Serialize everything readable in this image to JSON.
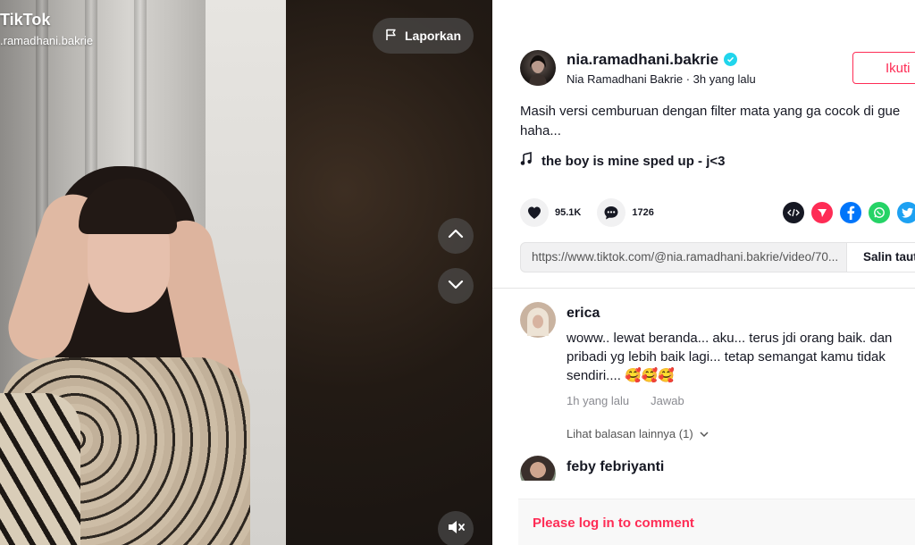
{
  "video": {
    "brand": "TikTok",
    "username": ".ramadhani.bakrie",
    "report_label": "Laporkan",
    "icons": [
      "flag-icon",
      "chevron-up-icon",
      "chevron-down-icon",
      "mute-icon"
    ]
  },
  "post": {
    "author_handle": "nia.ramadhani.bakrie",
    "author_name": "Nia Ramadhani Bakrie",
    "time": "3h yang lalu",
    "follow_label": "Ikuti",
    "caption_line1": "Masih versi cemburuan dengan filter mata yang ga cocok di gue",
    "caption_line2": "haha...",
    "music": "the boy is mine sped up - j<3",
    "likes": "95.1K",
    "comments_count": "1726",
    "link": "https://www.tiktok.com/@nia.ramadhani.bakrie/video/70...",
    "copy_label": "Salin taut"
  },
  "share_colors": {
    "embed": "#161823",
    "send": "#fe2c55",
    "facebook": "#0075fa",
    "whatsapp": "#25d366",
    "twitter": "#1da1f2"
  },
  "comments": [
    {
      "user": "erica",
      "text": "woww.. lewat beranda... aku... terus jdi orang baik. dan pribadi yg lebih baik lagi... tetap semangat kamu tidak sendiri.... 🥰🥰🥰",
      "time": "1h yang lalu",
      "reply_label": "Jawab",
      "more_replies": "Lihat balasan lainnya (1)"
    },
    {
      "user": "feby febriyanti"
    }
  ],
  "login_prompt": "Please log in to comment"
}
